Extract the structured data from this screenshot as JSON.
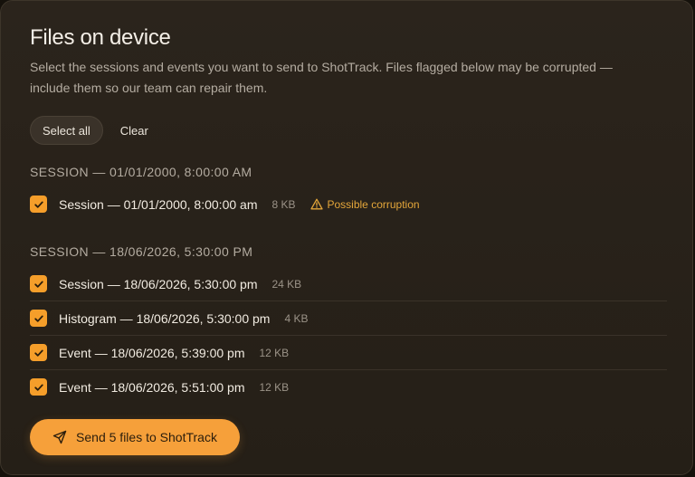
{
  "title": "Files on device",
  "description": "Select the sessions and events you want to send to ShotTrack. Files flagged below may be corrupted — include them so our team can repair them.",
  "actions": {
    "select_all": "Select all",
    "clear": "Clear"
  },
  "groups": [
    {
      "header": "SESSION — 01/01/2000, 8:00:00 AM",
      "items": [
        {
          "label": "Session — 01/01/2000, 8:00:00 am",
          "size": "8 KB",
          "checked": true,
          "warning": "Possible corruption"
        }
      ]
    },
    {
      "header": "SESSION — 18/06/2026, 5:30:00 PM",
      "items": [
        {
          "label": "Session — 18/06/2026, 5:30:00 pm",
          "size": "24 KB",
          "checked": true
        },
        {
          "label": "Histogram — 18/06/2026, 5:30:00 pm",
          "size": "4 KB",
          "checked": true
        },
        {
          "label": "Event — 18/06/2026, 5:39:00 pm",
          "size": "12 KB",
          "checked": true
        },
        {
          "label": "Event — 18/06/2026, 5:51:00 pm",
          "size": "12 KB",
          "checked": true
        }
      ]
    }
  ],
  "send_button": "Send 5 files to ShotTrack",
  "colors": {
    "accent": "#f6a03a",
    "warning": "#e3a63a",
    "panel": "#2b241c"
  },
  "icons": {
    "check": "check-icon",
    "warning": "warning-triangle-icon",
    "send": "paper-plane-icon"
  }
}
